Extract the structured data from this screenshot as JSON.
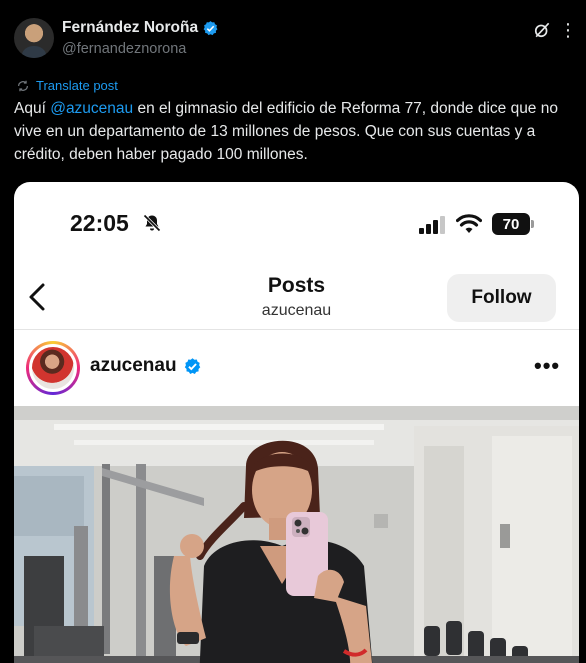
{
  "tweet": {
    "author_name": "Fernández Noroña",
    "author_handle": "@fernandeznorona",
    "translate_label": "Translate post",
    "text_before": "Aquí ",
    "mention": "@azucenau",
    "text_after": " en el gimnasio del edificio de Reforma 77, donde dice que no vive en un departamento de 13 millones de pesos. Que con sus cuentas y a crédito, deben haber pagado 100 millones."
  },
  "embedded_screenshot": {
    "status_bar": {
      "time": "22:05",
      "battery": "70"
    },
    "nav": {
      "title": "Posts",
      "subtitle": "azucenau",
      "follow_label": "Follow"
    },
    "post": {
      "username": "azucenau"
    }
  },
  "colors": {
    "background": "#000000",
    "text_primary": "#e7e9ea",
    "text_secondary": "#71767b",
    "link_blue": "#1d9bf0",
    "ig_verified": "#0095f6"
  },
  "icons": [
    "verified-badge-icon",
    "grok-icon",
    "more-icon",
    "translate-icon",
    "silent-bell-icon",
    "cellular-signal-icon",
    "wifi-icon",
    "battery-icon",
    "back-chevron-icon",
    "ig-verified-icon",
    "ellipsis-icon"
  ]
}
